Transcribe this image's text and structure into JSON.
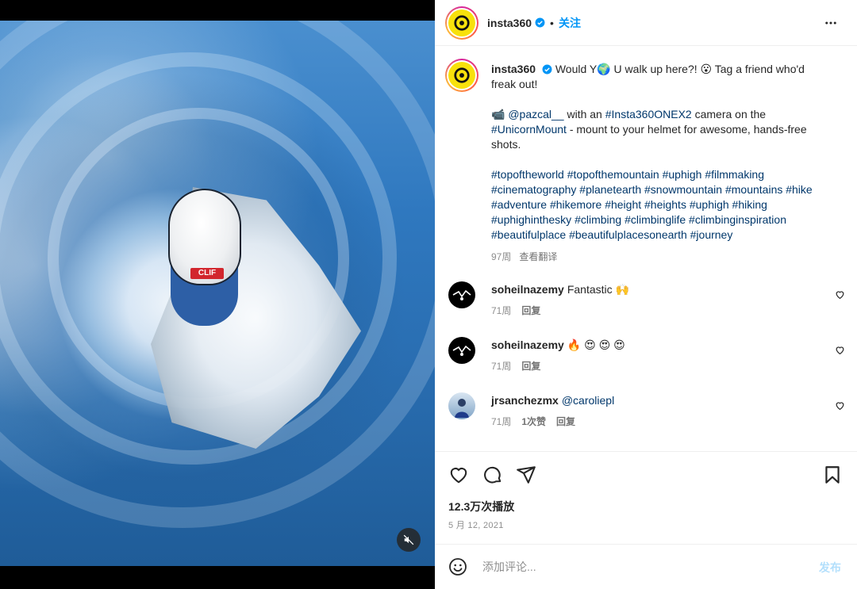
{
  "post": {
    "username": "insta360",
    "follow_label": "关注",
    "dot": "•"
  },
  "caption": {
    "username": "insta360",
    "line1_a": "Would Y",
    "line1_globe": "🌍",
    "line1_b": " U walk up here?! ",
    "line1_face": "😮",
    "line1_c": " Tag a friend who'd freak out!",
    "p2_icon": "📹",
    "p2_mention": "@pazcal__",
    "p2_text1": " with an ",
    "p2_tag1": "#Insta360ONEX2",
    "p2_text2": " camera on the ",
    "p2_tag2": "#UnicornMount",
    "p2_text3": " - mount to your helmet for awesome, hands-free shots.",
    "hashtags": "#topoftheworld #topofthemountain #uphigh #filmmaking #cinematography #planetearth #snowmountain #mountains #hike #adventure #hikemore #height #heights #uphigh #hiking #uphighinthesky #climbing #climbinglife #climbinginspiration #beautifulplace #beautifulplacesonearth #journey",
    "age": "97周",
    "translate": "查看翻译"
  },
  "comments": [
    {
      "username": "soheilnazemy",
      "text": "Fantastic 🙌",
      "age": "71周",
      "likes": "",
      "reply": "回复"
    },
    {
      "username": "soheilnazemy",
      "text": "🔥 😍 😍 😍",
      "age": "71周",
      "likes": "",
      "reply": "回复"
    },
    {
      "username": "jrsanchezmx",
      "text": "@caroliepl",
      "age": "71周",
      "likes": "1次赞",
      "reply": "回复"
    }
  ],
  "stats": {
    "views": "12.3万次播放",
    "date": "5 月 12, 2021"
  },
  "composer": {
    "placeholder": "添加评论...",
    "post_label": "发布"
  },
  "media": {
    "patch_text": "CLIF"
  },
  "colors": {
    "accent": "#0095f6",
    "link": "#00376b",
    "avatar_yellow": "#f8e10c"
  }
}
